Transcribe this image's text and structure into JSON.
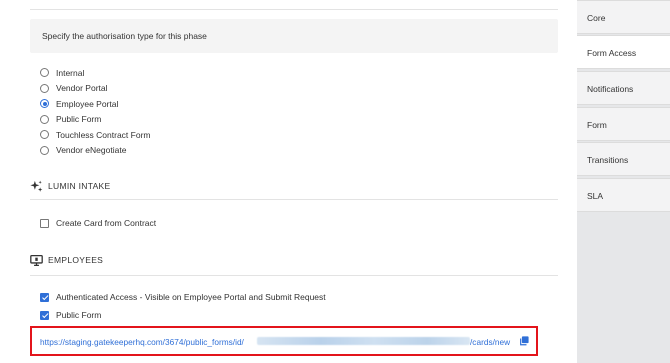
{
  "auth": {
    "prompt": "Specify the authorisation type for this phase",
    "options": [
      {
        "label": "Internal",
        "checked": false
      },
      {
        "label": "Vendor Portal",
        "checked": false
      },
      {
        "label": "Employee Portal",
        "checked": true
      },
      {
        "label": "Public Form",
        "checked": false
      },
      {
        "label": "Touchless Contract Form",
        "checked": false
      },
      {
        "label": "Vendor eNegotiate",
        "checked": false
      }
    ]
  },
  "lumin": {
    "title": "LUMIN INTAKE",
    "icon": "sparkle-icon",
    "create_card_label": "Create Card from Contract",
    "create_card_checked": false
  },
  "employees": {
    "title": "EMPLOYEES",
    "icon": "monitor-icon",
    "authenticated_label": "Authenticated Access - Visible on Employee Portal and Submit Request",
    "authenticated_checked": true,
    "public_form_label": "Public Form",
    "public_form_checked": true,
    "link_prefix": "https://staging.gatekeeperhq.com/3674/public_forms/id/",
    "link_suffix": "/cards/new",
    "copy_icon": "copy-icon"
  },
  "colors": {
    "accent": "#2f6fd7",
    "highlight_border": "#e3141b"
  },
  "sidebar": {
    "tabs": [
      {
        "label": "Core",
        "active": false
      },
      {
        "label": "Form Access",
        "active": true
      },
      {
        "label": "Notifications",
        "active": false
      },
      {
        "label": "Form",
        "active": false
      },
      {
        "label": "Transitions",
        "active": false
      },
      {
        "label": "SLA",
        "active": false
      }
    ]
  }
}
